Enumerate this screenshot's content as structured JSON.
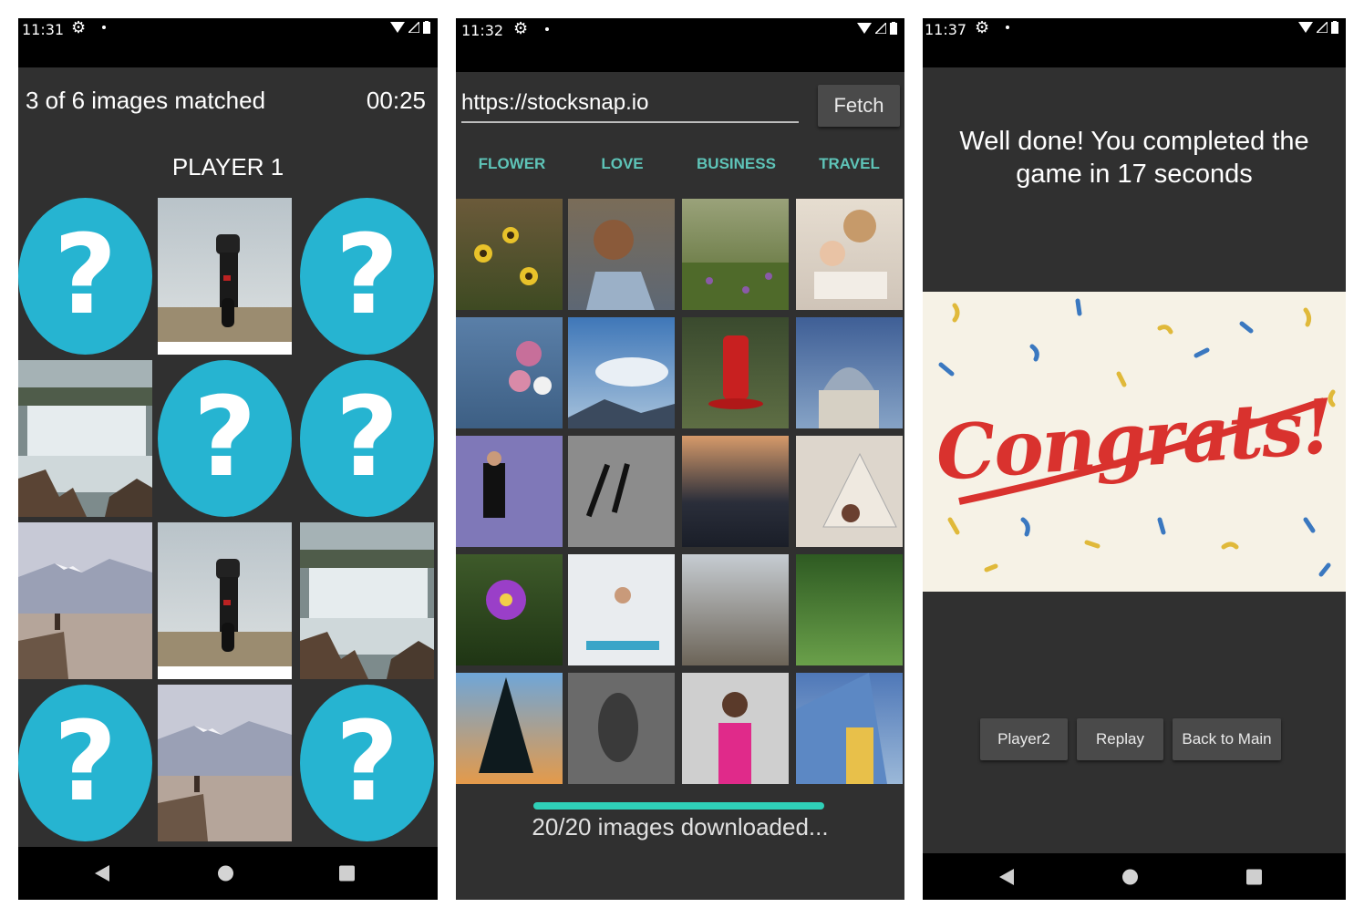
{
  "screens": [
    {
      "status": {
        "time": "11:31"
      },
      "header": {
        "matched_text": "3 of 6 images matched",
        "timer": "00:25"
      },
      "player_label": "PLAYER 1",
      "cards": [
        {
          "type": "hidden",
          "label": "?"
        },
        {
          "type": "image",
          "name": "motorcycle-photo"
        },
        {
          "type": "hidden",
          "label": "?"
        },
        {
          "type": "image",
          "name": "waterfall-photo"
        },
        {
          "type": "hidden",
          "label": "?"
        },
        {
          "type": "hidden",
          "label": "?"
        },
        {
          "type": "image",
          "name": "mountain-cliff-photo"
        },
        {
          "type": "image",
          "name": "motorcycle-photo"
        },
        {
          "type": "image",
          "name": "waterfall-photo"
        },
        {
          "type": "hidden",
          "label": "?"
        },
        {
          "type": "image",
          "name": "mountain-cliff-photo"
        },
        {
          "type": "hidden",
          "label": "?"
        }
      ]
    },
    {
      "status": {
        "time": "11:32"
      },
      "url_field": {
        "value": "https://stocksnap.io"
      },
      "fetch_label": "Fetch",
      "tabs": [
        "FLOWER",
        "LOVE",
        "BUSINESS",
        "TRAVEL"
      ],
      "progress": {
        "fraction": 1.0,
        "text": "20/20 images downloaded..."
      }
    },
    {
      "status": {
        "time": "11:37"
      },
      "message": "Well done! You completed the game in 17 seconds",
      "congrats_text": "Congrats!",
      "buttons": [
        "Player2",
        "Replay",
        "Back to Main"
      ]
    }
  ],
  "colors": {
    "card_back": "#26b4d1",
    "accent_teal": "#5ec4b8",
    "progress": "#2fd0b8",
    "background": "#303030"
  }
}
